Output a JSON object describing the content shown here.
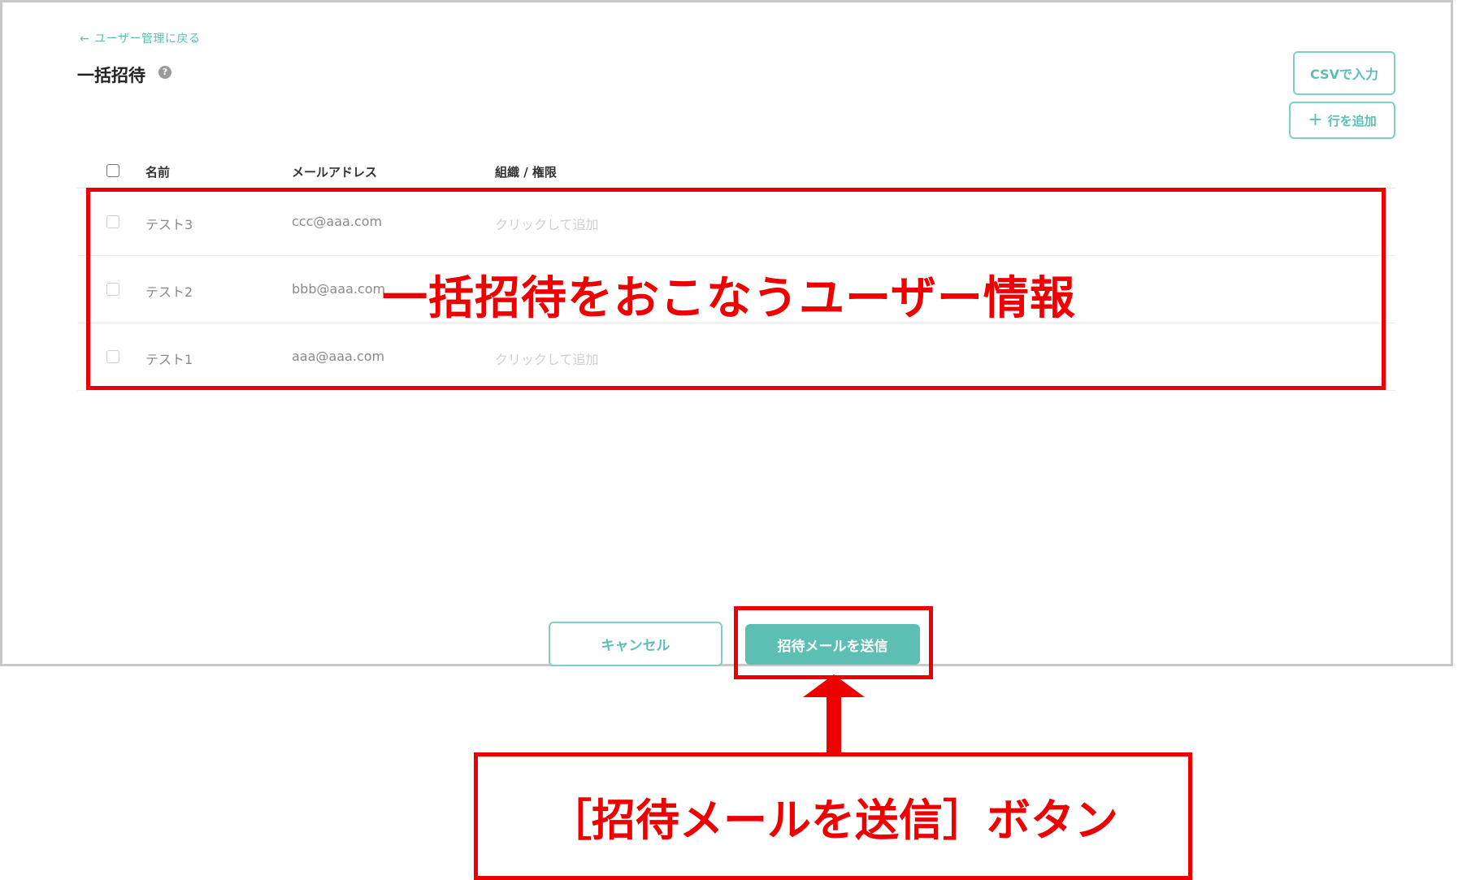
{
  "nav": {
    "back_icon": "arrow-left-icon",
    "back_label": "ユーザー管理に戻る"
  },
  "page": {
    "title": "一括招待",
    "help_icon": "?"
  },
  "actions": {
    "csv_label": "CSVで入力",
    "add_row_icon": "+",
    "add_row_label": "行を追加"
  },
  "table": {
    "columns": {
      "name": "名前",
      "email": "メールアドレス",
      "org": "組織 / 権限"
    },
    "rows": [
      {
        "name": "テスト3",
        "email": "ccc@aaa.com",
        "org": "クリックして追加"
      },
      {
        "name": "テスト2",
        "email": "bbb@aaa.com",
        "org": ""
      },
      {
        "name": "テスト1",
        "email": "aaa@aaa.com",
        "org": "クリックして追加"
      }
    ]
  },
  "footer": {
    "cancel_label": "キャンセル",
    "send_label": "招待メールを送信"
  },
  "annotations": {
    "table_note": "一括招待をおこなうユーザー情報",
    "button_note": "［招待メールを送信］ボタン"
  },
  "colors": {
    "accent": "#5dbfb3",
    "highlight": "#ee0000",
    "frame": "#c8c8c8"
  }
}
